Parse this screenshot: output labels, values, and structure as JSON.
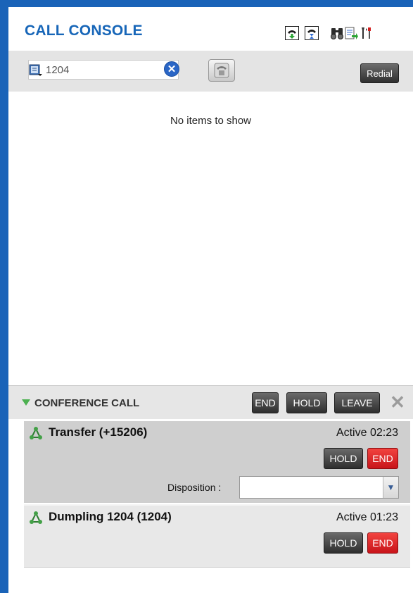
{
  "header": {
    "title": "CALL CONSOLE"
  },
  "toolbar": {
    "icons": [
      "transfer-icon",
      "hold-queue-icon",
      "directory-search-icon",
      "notes-icon",
      "settings-icon"
    ]
  },
  "dialer": {
    "number_value": "1204",
    "redial_label": "Redial"
  },
  "calls_list": {
    "empty_message": "No items to show"
  },
  "conference": {
    "label": "CONFERENCE CALL",
    "end_label": "END",
    "hold_label": "HOLD",
    "leave_label": "LEAVE",
    "close_glyph": "✕"
  },
  "parties": [
    {
      "name": "Transfer (+15206)",
      "status": "Active 02:23",
      "hold_label": "HOLD",
      "end_label": "END",
      "disposition_label": "Disposition :",
      "disposition_value": ""
    },
    {
      "name": "Dumpling 1204 (1204)",
      "status": "Active 01:23",
      "hold_label": "HOLD",
      "end_label": "END"
    }
  ],
  "colors": {
    "frame_blue": "#1a63b8",
    "title_blue": "#1766b8",
    "end_red": "#d8221f",
    "conference_arrow_green": "#4cb050"
  }
}
